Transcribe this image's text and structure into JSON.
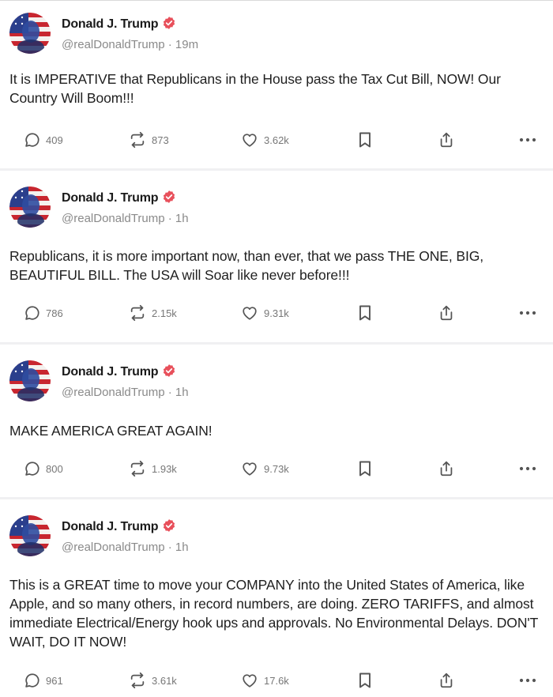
{
  "colors": {
    "verified": "#e8505b",
    "icon": "#555555",
    "meta": "#8a8a8a"
  },
  "posts": [
    {
      "author": "Donald J. Trump",
      "handle": "@realDonaldTrump",
      "time": "19m",
      "text": "It is IMPERATIVE that Republicans in the House pass the Tax Cut Bill, NOW! Our Country Will Boom!!!",
      "replies": "409",
      "reposts": "873",
      "likes": "3.62k"
    },
    {
      "author": "Donald J. Trump",
      "handle": "@realDonaldTrump",
      "time": "1h",
      "text": "Republicans, it is more important now, than ever, that we pass THE ONE, BIG, BEAUTIFUL BILL. The USA will Soar like never before!!!",
      "replies": "786",
      "reposts": "2.15k",
      "likes": "9.31k"
    },
    {
      "author": "Donald J. Trump",
      "handle": "@realDonaldTrump",
      "time": "1h",
      "text": "MAKE AMERICA GREAT AGAIN!",
      "replies": "800",
      "reposts": "1.93k",
      "likes": "9.73k"
    },
    {
      "author": "Donald J. Trump",
      "handle": "@realDonaldTrump",
      "time": "1h",
      "text": "This is a GREAT time to move your COMPANY into the United States of America, like Apple, and so many others, in record numbers, are doing. ZERO TARIFFS, and almost immediate Electrical/Energy hook ups and approvals. No Environmental Delays. DON'T WAIT, DO IT NOW!",
      "replies": "961",
      "reposts": "3.61k",
      "likes": "17.6k"
    }
  ]
}
